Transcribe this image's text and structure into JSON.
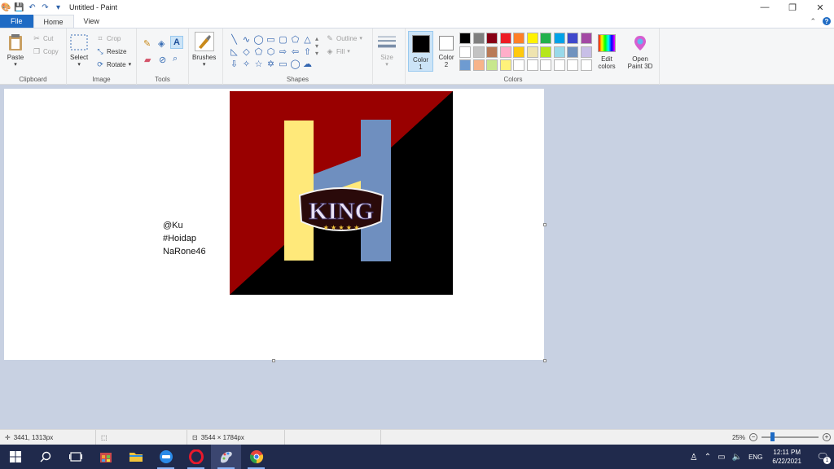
{
  "window": {
    "title": "Untitled - Paint",
    "controls": {
      "minimize": "—",
      "restore": "❐",
      "close": "✕"
    }
  },
  "tabs": [
    {
      "label": "File"
    },
    {
      "label": "Home"
    },
    {
      "label": "View"
    }
  ],
  "ribbon": {
    "clipboard": {
      "paste": "Paste",
      "cut": "Cut",
      "copy": "Copy",
      "label": "Clipboard"
    },
    "image": {
      "select": "Select",
      "crop": "Crop",
      "resize": "Resize",
      "rotate": "Rotate",
      "label": "Image"
    },
    "tools": {
      "label": "Tools"
    },
    "brushes": {
      "label": "Brushes"
    },
    "shapes": {
      "outline": "Outline",
      "fill": "Fill",
      "label": "Shapes"
    },
    "size": {
      "label": "Size"
    },
    "colors": {
      "color1": "Color\n1",
      "color2": "Color\n2",
      "edit": "Edit\ncolors",
      "paint3d": "Open\nPaint 3D",
      "label": "Colors",
      "color1_value": "#000000",
      "color2_value": "#ffffff",
      "palette": [
        "#000000",
        "#7f7f7f",
        "#880015",
        "#ed1c24",
        "#ff7f27",
        "#fff200",
        "#22b14c",
        "#00a2e8",
        "#3f48cc",
        "#a349a4",
        "#ffffff",
        "#c3c3c3",
        "#b97a57",
        "#ffaec9",
        "#ffc90e",
        "#efe4b0",
        "#b5e61d",
        "#99d9ea",
        "#7092be",
        "#c8bfe7",
        "#6e9bd1",
        "#f7b48a",
        "#c8e78d",
        "#fff27a",
        "#ffffff",
        "#ffffff",
        "#ffffff",
        "#ffffff",
        "#ffffff",
        "#ffffff"
      ]
    }
  },
  "canvas": {
    "text_lines": [
      "@Ku",
      "#Hoidap",
      "NaRone46"
    ],
    "logo_text": "KING",
    "art_colors": {
      "red": "#990000",
      "black": "#000000",
      "yellow": "#ffe97a",
      "blue": "#6f8fbf"
    }
  },
  "statusbar": {
    "cursor_pos": "3441, 1313px",
    "image_size": "3544 × 1784px",
    "zoom": "25%",
    "zoom_fraction": 0.25
  },
  "taskbar": {
    "clock_time": "12:11 PM",
    "clock_date": "6/22/2021",
    "language": "ENG",
    "notification_count": "1"
  }
}
